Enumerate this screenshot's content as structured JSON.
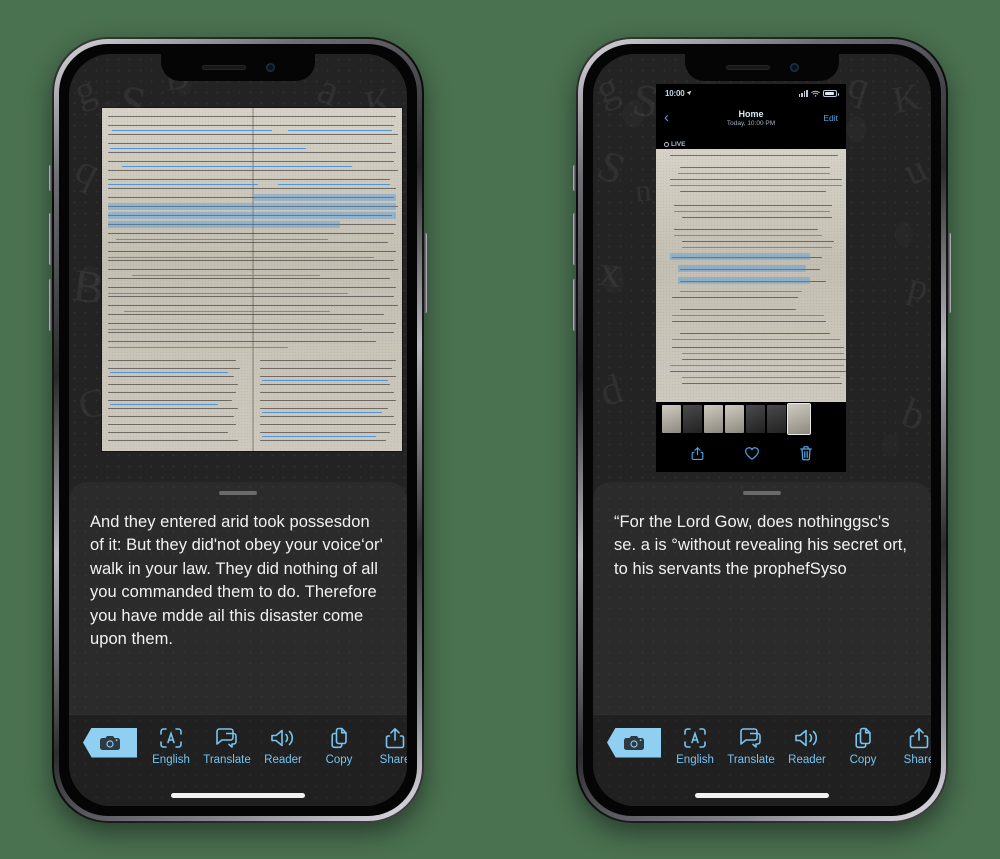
{
  "scene": {
    "background_color": "#4a7150",
    "device_count": 2
  },
  "phones": [
    {
      "id": "left",
      "recognized_text": "And they entered arid took possesdon of it: But they did'not obey your voice‘or' walk in your law. They did nothing of all you commanded them to do. Therefore you have mdde ail this disaster come upon them.",
      "photo": {
        "kind": "bible-page-photo",
        "description": "Open study Bible showing Jeremiah 32 with blue Live Text selection highlight"
      },
      "toolbar": {
        "camera_button": "camera-icon",
        "items": [
          {
            "icon": "scan-text-icon",
            "label": "English"
          },
          {
            "icon": "translate-bubbles-icon",
            "label": "Translate"
          },
          {
            "icon": "speaker-icon",
            "label": "Reader"
          },
          {
            "icon": "copy-pages-icon",
            "label": "Copy"
          },
          {
            "icon": "share-icon",
            "label": "Share"
          }
        ]
      }
    },
    {
      "id": "right",
      "recognized_text": "“For the Lord Gow, does nothinggsc's se. a is °without revealing his secret ort, to his servants the prophefSyso",
      "nested_screenshot": {
        "status_bar": {
          "time": "10:00",
          "location_icon": "location-arrow-icon",
          "signal_icon": "cellular-bars-icon",
          "wifi_icon": "wifi-icon",
          "battery_icon": "battery-icon"
        },
        "nav_bar": {
          "back_icon": "chevron-left-icon",
          "title": "Home",
          "subtitle": "Today, 10:00 PM",
          "edit_label": "Edit"
        },
        "badge": {
          "icon": "live-photo-icon",
          "label": "LIVE"
        },
        "photo_description": "Bible page showing Amos 3 with blue Live Text highlight on verse 7",
        "thumbnail_count": 7,
        "actions": [
          {
            "icon": "share-icon",
            "name": "share"
          },
          {
            "icon": "heart-icon",
            "name": "favorite"
          },
          {
            "icon": "trash-icon",
            "name": "delete"
          }
        ]
      },
      "toolbar": {
        "camera_button": "camera-icon",
        "items": [
          {
            "icon": "scan-text-icon",
            "label": "English"
          },
          {
            "icon": "translate-bubbles-icon",
            "label": "Translate"
          },
          {
            "icon": "speaker-icon",
            "label": "Reader"
          },
          {
            "icon": "copy-pages-icon",
            "label": "Copy"
          },
          {
            "icon": "share-icon",
            "label": "Share"
          }
        ]
      }
    }
  ],
  "colors": {
    "accent": "#78c4f0",
    "camera_button": "#8fd0f2",
    "sheet_bg": "#2b2b2b",
    "highlight": "#4696e1"
  }
}
